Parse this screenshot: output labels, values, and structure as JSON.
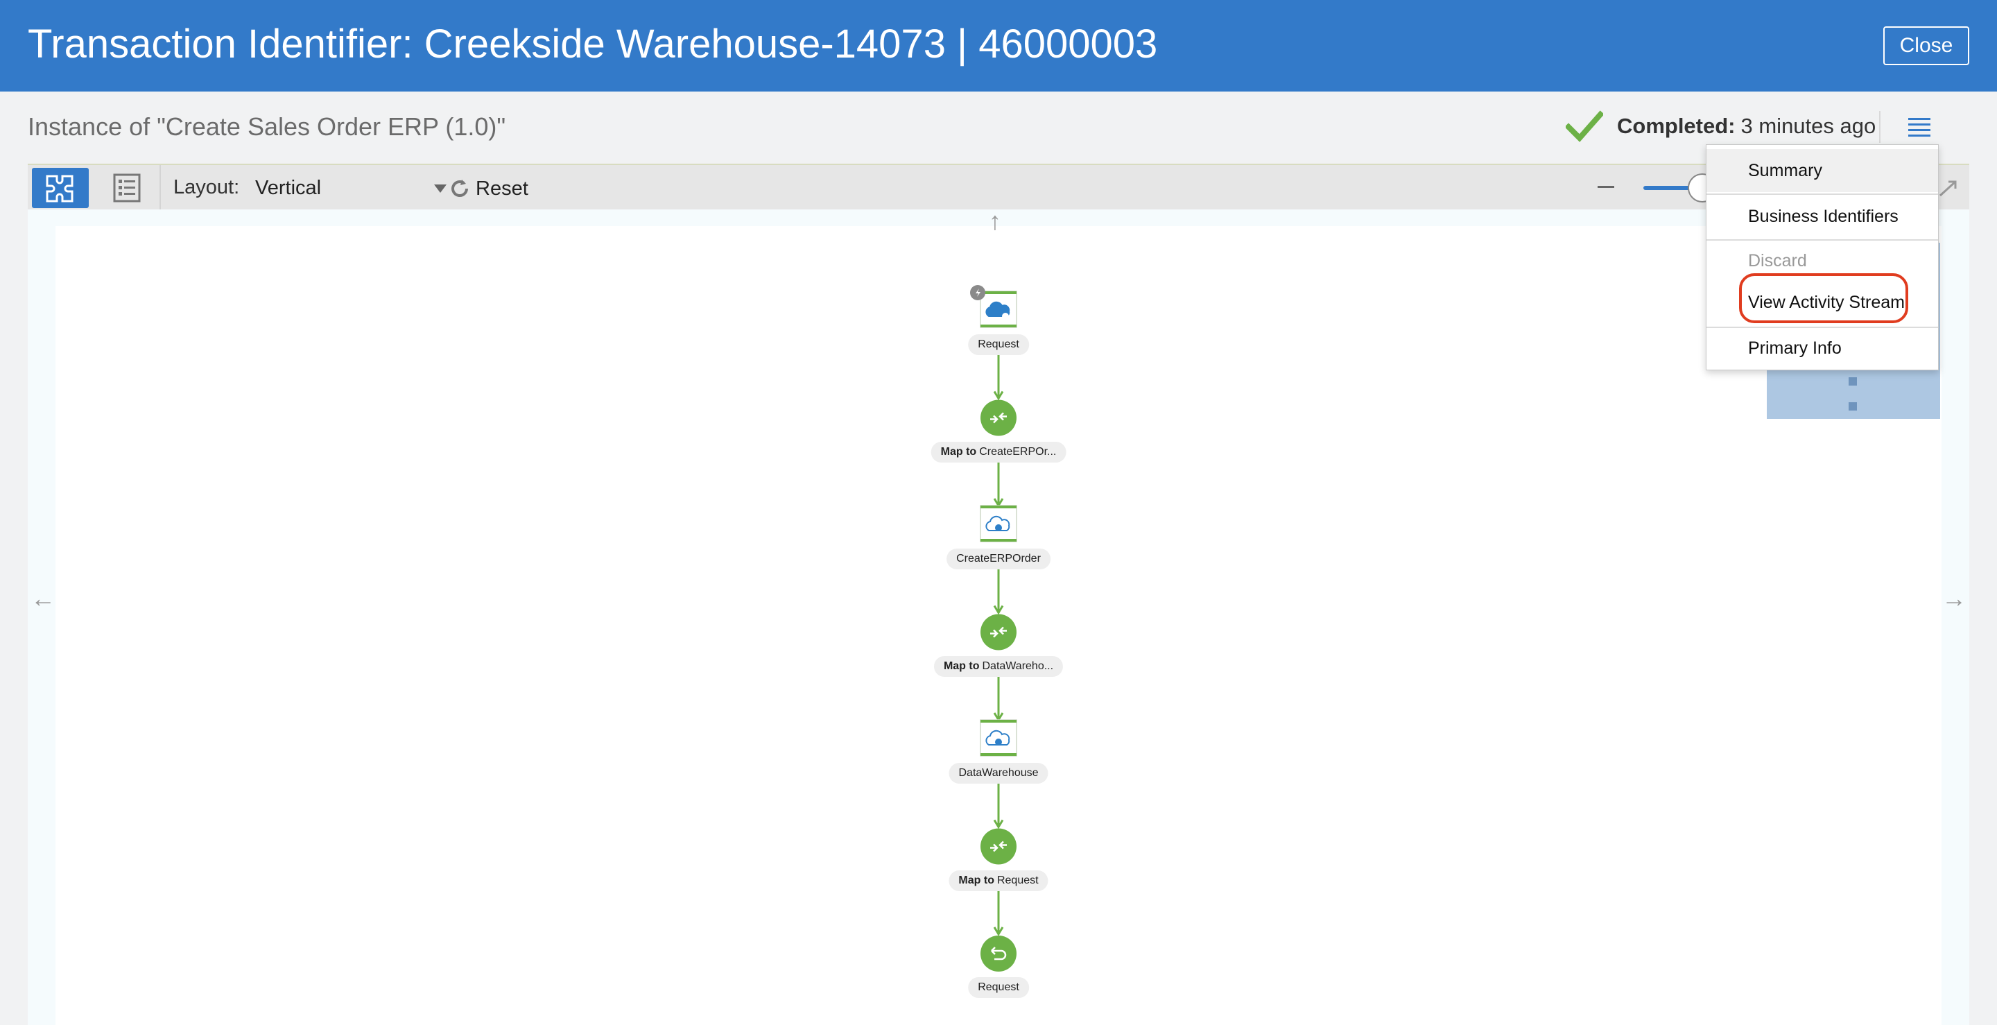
{
  "header": {
    "title": "Transaction Identifier: Creekside Warehouse-14073 | 46000003",
    "close_label": "Close",
    "bg_color": "#337ac9"
  },
  "instance": {
    "label": "Instance of \"Create Sales Order ERP (1.0)\"",
    "status_label": "Completed:",
    "status_time": "3 minutes ago",
    "status_color": "#6cb146"
  },
  "toolbar": {
    "layout_label": "Layout:",
    "layout_value": "Vertical",
    "reset_label": "Reset"
  },
  "flow": {
    "nodes": [
      {
        "kind": "invoke-trigger",
        "icon": "cloud-trigger-icon",
        "label_bold": "",
        "label": "Request"
      },
      {
        "kind": "map",
        "icon": "map-icon",
        "label_bold": "Map to",
        "label": "CreateERPOr..."
      },
      {
        "kind": "invoke",
        "icon": "cloud-invoke-icon",
        "label_bold": "",
        "label": "CreateERPOrder"
      },
      {
        "kind": "map",
        "icon": "map-icon",
        "label_bold": "Map to",
        "label": "DataWareho..."
      },
      {
        "kind": "invoke",
        "icon": "cloud-invoke-icon",
        "label_bold": "",
        "label": "DataWarehouse"
      },
      {
        "kind": "map",
        "icon": "map-icon",
        "label_bold": "Map to",
        "label": "Request"
      },
      {
        "kind": "return",
        "icon": "return-icon",
        "label_bold": "",
        "label": "Request"
      }
    ],
    "line_color": "#6cb146"
  },
  "menu": {
    "items": [
      {
        "label": "Summary",
        "state": "hover"
      },
      {
        "label": "Business Identifiers",
        "state": "normal"
      },
      {
        "label": "Discard",
        "state": "disabled"
      },
      {
        "label": "View Activity Stream",
        "state": "highlighted"
      },
      {
        "label": "Primary Info",
        "state": "normal"
      }
    ],
    "highlight_color": "#e03c1f"
  }
}
